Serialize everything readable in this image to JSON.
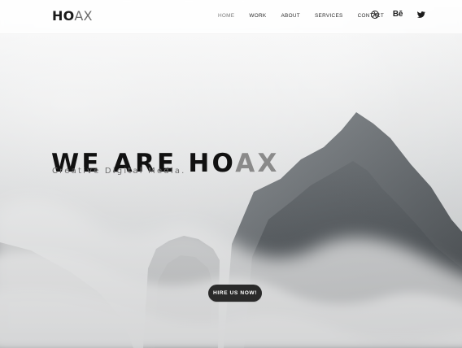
{
  "header": {
    "logo": {
      "part1": "HO",
      "part2": "AX"
    },
    "nav": [
      {
        "label": "HOME",
        "active": true
      },
      {
        "label": "WORK",
        "active": false
      },
      {
        "label": "ABOUT",
        "active": false
      },
      {
        "label": "SERVICES",
        "active": false
      },
      {
        "label": "CONTACT",
        "active": false
      }
    ],
    "social": [
      {
        "name": "dribbble-icon"
      },
      {
        "name": "behance-icon",
        "text": "Bē"
      },
      {
        "name": "twitter-icon"
      }
    ]
  },
  "hero": {
    "headline_prefix": "WE ARE HO",
    "headline_suffix": "AX",
    "subheadline": "Creative Digital Media.",
    "cta": "HIRE US NOW!"
  },
  "colors": {
    "nav_bg": "#ffffff",
    "text_dark": "#111111",
    "text_muted": "#8a8a8a",
    "cta_bg": "#2a2a2a"
  }
}
